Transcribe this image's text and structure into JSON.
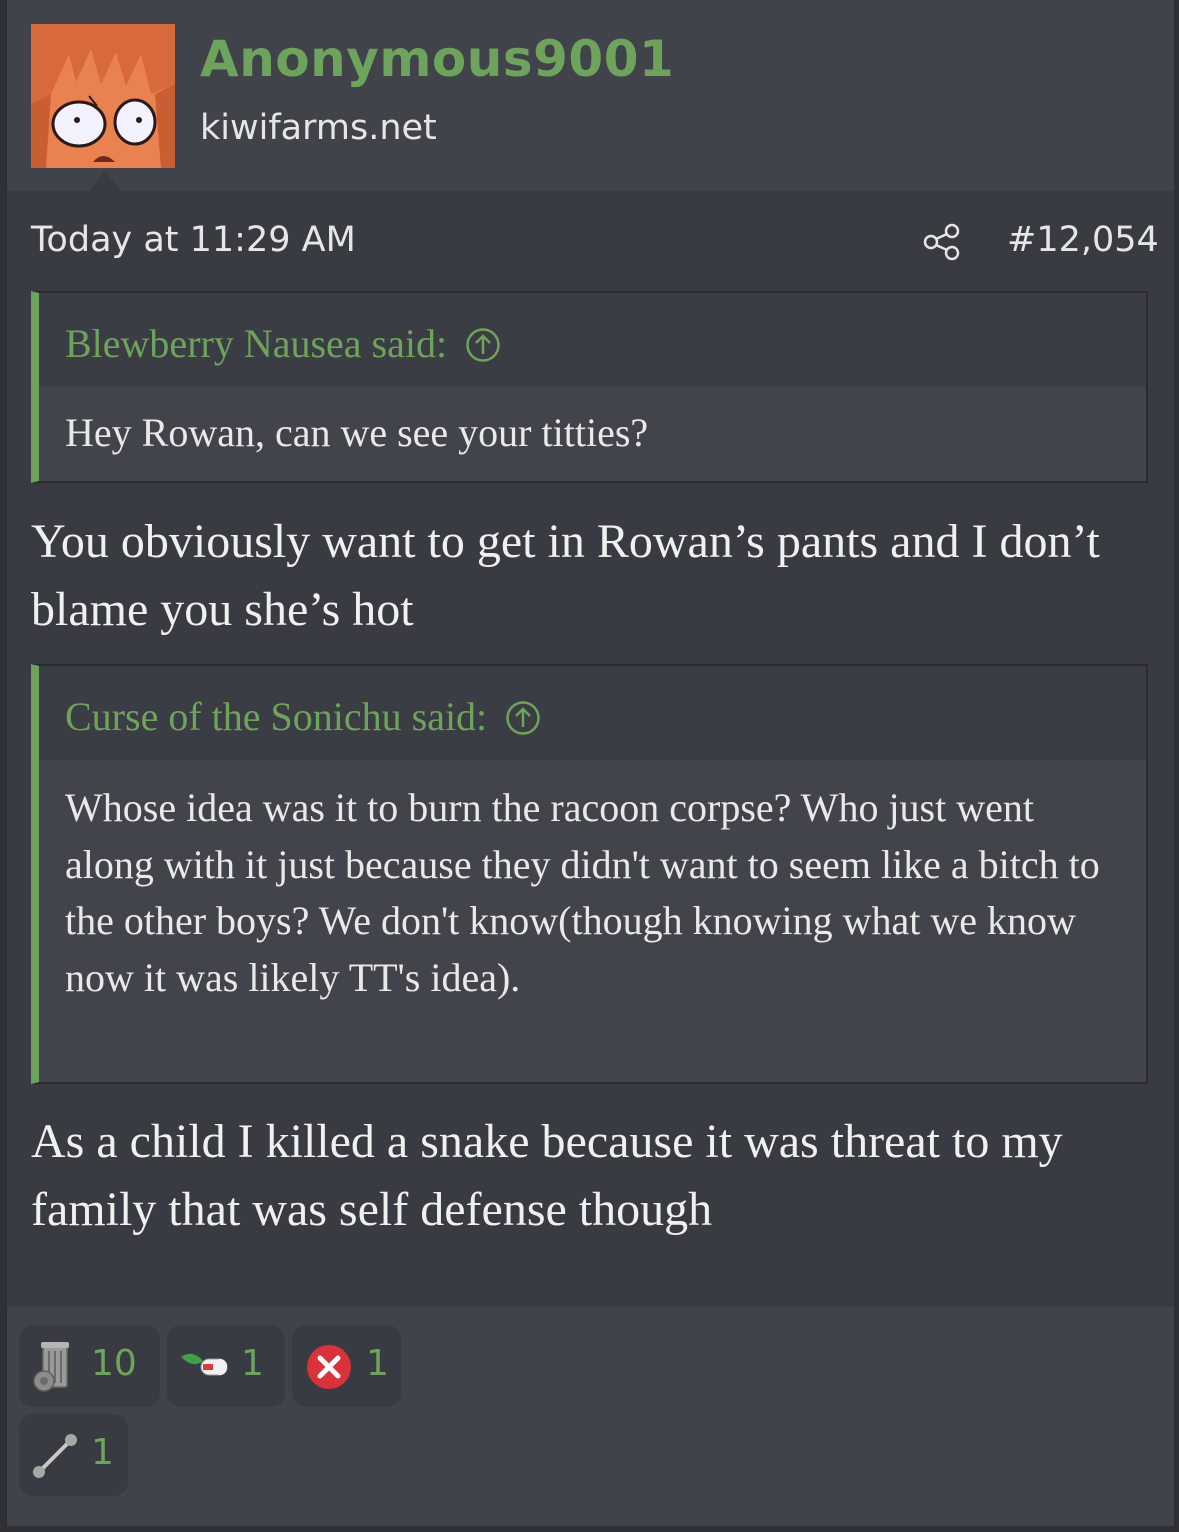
{
  "user": {
    "name": "Anonymous9001",
    "title": "kiwifarms.net"
  },
  "post": {
    "date": "Today at 11:29 AM",
    "number": "#12,054"
  },
  "quotes": [
    {
      "author": "Blewberry Nausea said:",
      "text": "Hey Rowan, can we see your titties?"
    },
    {
      "author": "Curse of the Sonichu said:",
      "text": "Whose idea was it to burn the racoon corpse? Who just went along with it just because they didn't want to seem like a bitch to the other boys? We don't know(though knowing what we know now it was likely TT's idea)."
    }
  ],
  "messages": [
    "You obviously want to get in Rowan’s pants and I don’t blame you she’s hot",
    "As a child I killed a snake because it was threat to my family that was self defense though"
  ],
  "reactions": [
    {
      "icon": "trash-can-icon",
      "count": "10"
    },
    {
      "icon": "medicine-pill-icon",
      "count": "1"
    },
    {
      "icon": "red-x-icon",
      "count": "1"
    },
    {
      "icon": "barbell-icon",
      "count": "1"
    }
  ],
  "colors": {
    "accent": "#6ea35b",
    "background": "#383b41",
    "quote_bg": "#41444b",
    "text": "#f0f0f0"
  }
}
